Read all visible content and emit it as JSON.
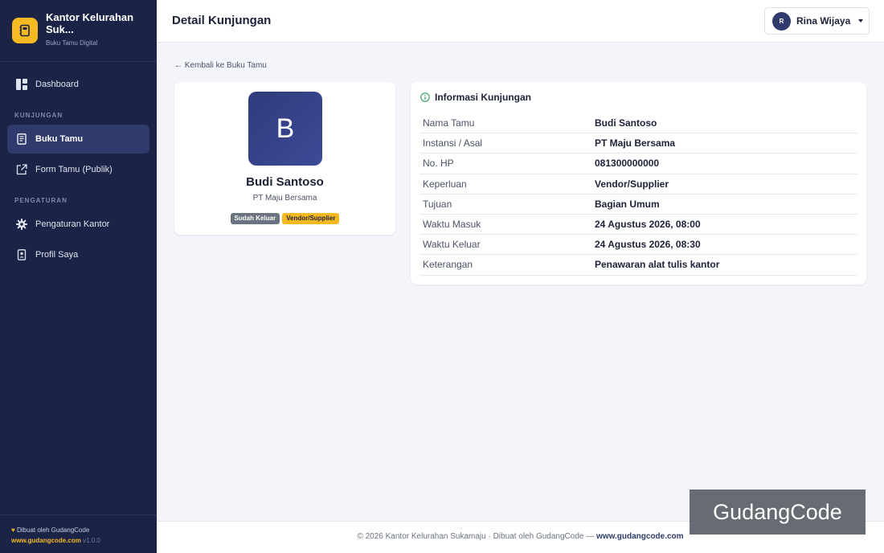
{
  "brand": {
    "title": "Kantor Kelurahan Suk...",
    "subtitle": "Buku Tamu Digital",
    "logo_icon": "guestbook-icon",
    "accent": "#f5b921"
  },
  "sidebar": {
    "dashboard": "Dashboard",
    "section_kunjungan": "KUNJUNGAN",
    "buku_tamu": "Buku Tamu",
    "form_tamu": "Form Tamu (Publik)",
    "section_pengaturan": "PENGATURAN",
    "pengaturan_kantor": "Pengaturan Kantor",
    "profil_saya": "Profil Saya",
    "footer_made_by": "Dibuat oleh GudangCode",
    "footer_link": "www.gudangcode.com",
    "footer_version": "v1.0.0"
  },
  "header": {
    "title": "Detail Kunjungan",
    "user_initial": "R",
    "user_name": "Rina Wijaya"
  },
  "back_link": "← Kembali ke Buku Tamu",
  "profile": {
    "initial": "B",
    "name": "Budi Santoso",
    "org": "PT Maju Bersama",
    "status_badge": "Sudah Keluar",
    "category_badge": "Vendor/Supplier"
  },
  "info": {
    "title": "Informasi Kunjungan",
    "rows": [
      {
        "label": "Nama Tamu",
        "value": "Budi Santoso"
      },
      {
        "label": "Instansi / Asal",
        "value": "PT Maju Bersama"
      },
      {
        "label": "No. HP",
        "value": "081300000000"
      },
      {
        "label": "Keperluan",
        "value": "Vendor/Supplier"
      },
      {
        "label": "Tujuan",
        "value": "Bagian Umum"
      },
      {
        "label": "Waktu Masuk",
        "value": "24 Agustus 2026, 08:00"
      },
      {
        "label": "Waktu Keluar",
        "value": "24 Agustus 2026, 08:30"
      },
      {
        "label": "Keterangan",
        "value": "Penawaran alat tulis kantor"
      }
    ]
  },
  "footer": {
    "text": "© 2026 Kantor Kelurahan Sukamaju · Dibuat oleh GudangCode — ",
    "link": "www.gudangcode.com"
  },
  "watermark": "GudangCode"
}
